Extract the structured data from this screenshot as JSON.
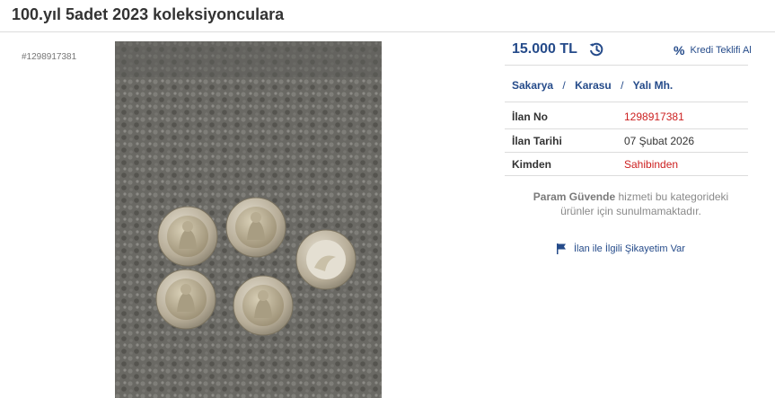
{
  "listing": {
    "title": "100.yıl 5adet 2023 koleksiyonculara",
    "ad_id_tag": "#1298917381"
  },
  "price": {
    "amount": "15.000 TL",
    "history_icon": "price-history-icon",
    "credit_label": "Kredi Teklifi Al",
    "credit_icon": "percent-icon",
    "color": "#254b8a"
  },
  "location": {
    "city": "Sakarya",
    "district": "Karasu",
    "neighborhood": "Yalı Mh.",
    "separator": "/"
  },
  "info": {
    "ad_no_label": "İlan No",
    "ad_no_value": "1298917381",
    "date_label": "İlan Tarihi",
    "date_value": "07 Şubat 2026",
    "from_label": "Kimden",
    "from_value": "Sahibinden",
    "highlight_color": "#cc1f1f"
  },
  "guarantee": {
    "brand": "Param Güvende",
    "text_line1": " hizmeti bu kategorideki",
    "text_line2": "ürünler için sunulmamaktadır."
  },
  "complaint": {
    "label": "İlan ile İlgili Şikayetim Var",
    "icon": "flag-icon"
  },
  "photo": {
    "subject": "five commemorative coins on a grey textured blanket"
  }
}
